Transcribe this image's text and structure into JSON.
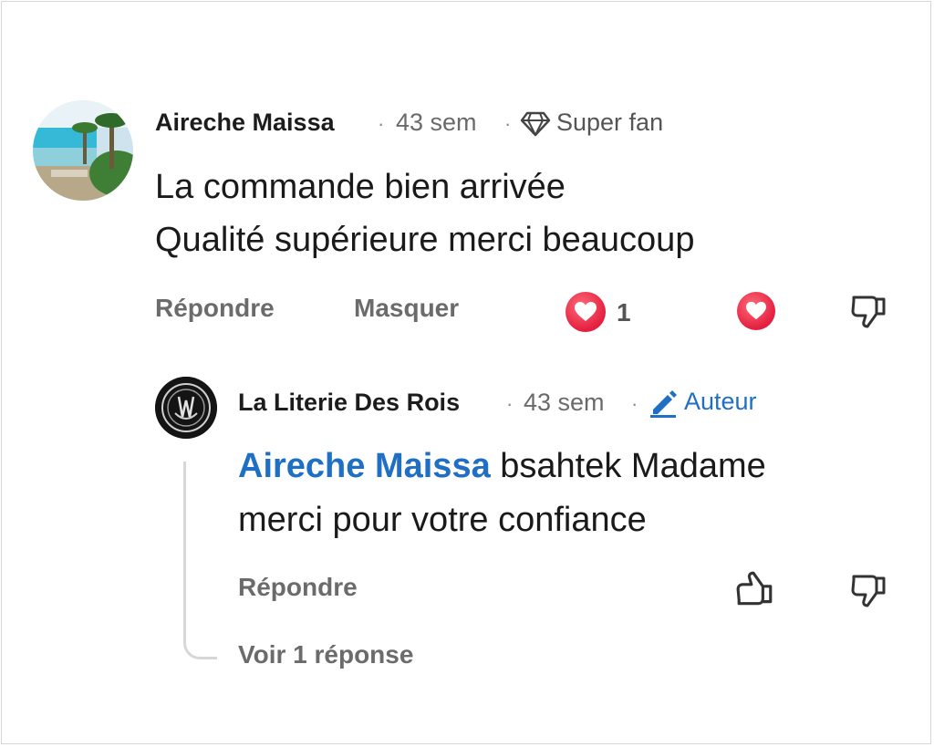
{
  "comment": {
    "author": "Aireche Maissa",
    "time": "43 sem",
    "badge": "Super fan",
    "badge_icon": "diamond-icon",
    "text_line1": "La commande bien arrivée",
    "text_line2": "Qualité supérieure merci beaucoup",
    "actions": {
      "reply": "Répondre",
      "hide": "Masquer"
    },
    "reaction_count": "1"
  },
  "reply": {
    "author": "La Literie Des Rois",
    "time": "43 sem",
    "badge": "Auteur",
    "badge_icon": "pencil-icon",
    "mention": "Aireche Maissa",
    "text_line1_rest": " bsahtek Madame",
    "text_line2": "merci pour votre confiance",
    "actions": {
      "reply": "Répondre"
    },
    "view_replies": "Voir 1 réponse"
  },
  "colors": {
    "accent": "#1f6fc5",
    "heart": "#e41e3f",
    "text": "#1a1a1a",
    "muted": "#6b6b6b"
  }
}
